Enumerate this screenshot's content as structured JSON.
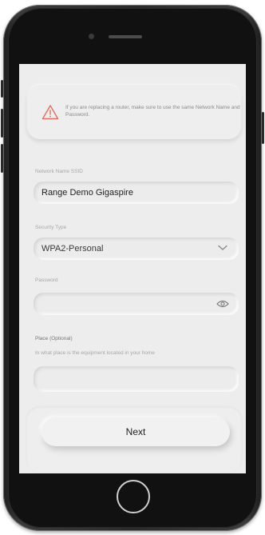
{
  "notice": {
    "text": "If you are replacing a router, make sure to use the same Network Name and Password."
  },
  "network": {
    "label": "Network Name SSID",
    "value": "Range Demo Gigaspire"
  },
  "security": {
    "label": "Security Type",
    "value": "WPA2-Personal"
  },
  "password": {
    "label": "Password",
    "value": ""
  },
  "place": {
    "label": "Place (Optional)",
    "hint": "In what place is the equipment located in your home",
    "value": ""
  },
  "actions": {
    "next_label": "Next"
  },
  "colors": {
    "warning": "#e07060",
    "screen_bg": "#ededed"
  },
  "icons": {
    "warning": "warning-triangle-icon",
    "dropdown": "chevron-down-icon",
    "reveal": "eye-icon"
  }
}
